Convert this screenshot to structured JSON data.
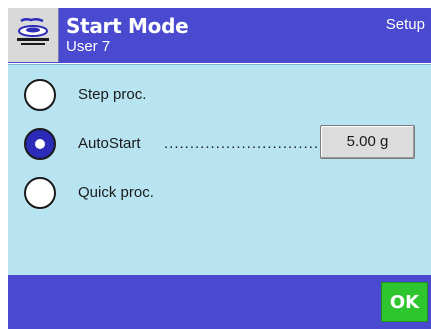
{
  "header": {
    "title": "Start Mode",
    "user": "User 7",
    "setup": "Setup",
    "app_icon": "balance-scale-icon"
  },
  "options": [
    {
      "label": "Step proc.",
      "selected": false
    },
    {
      "label": "AutoStart",
      "selected": true,
      "dots": "..............................",
      "value": "5.00 g"
    },
    {
      "label": "Quick proc.",
      "selected": false
    }
  ],
  "footer": {
    "ok_label": "OK"
  },
  "colors": {
    "header_bg": "#4a4ad0",
    "content_bg": "#b8e4f2",
    "ok_bg": "#2ec52e",
    "radio_selected": "#2b2bb8"
  }
}
